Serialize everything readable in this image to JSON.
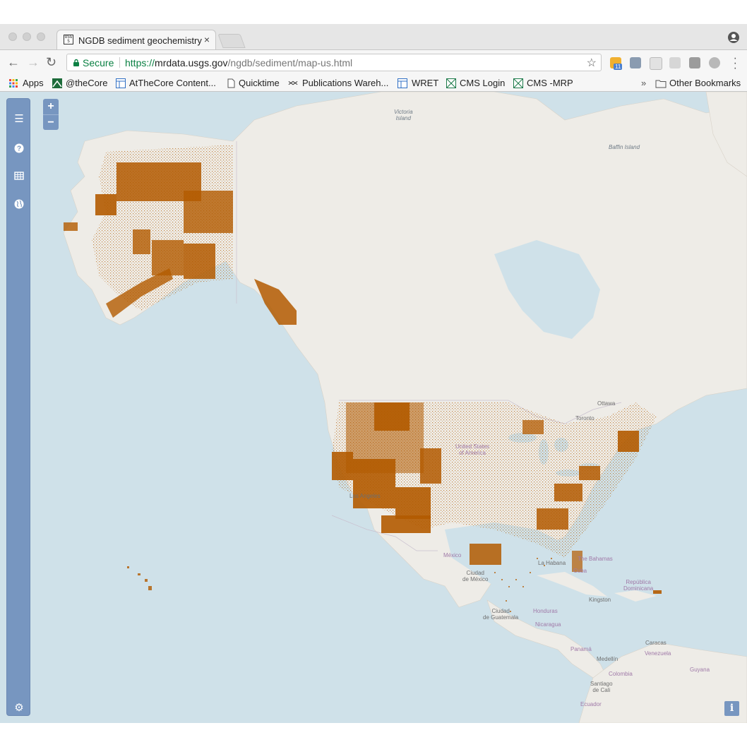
{
  "browser": {
    "tab": {
      "title": "NGDB sediment geochemistry",
      "favicon_text": "USGS",
      "close_glyph": "×"
    },
    "address": {
      "secure_label": "Secure",
      "url_scheme": "https://",
      "url_host": "mrdata.usgs.gov",
      "url_path": "/ngdb/sediment/map-us.html"
    },
    "bookmarks": [
      {
        "label": "Apps",
        "icon": "apps-grid-icon"
      },
      {
        "label": "@theCore",
        "icon": "thecore-icon"
      },
      {
        "label": "AtTheCore Content...",
        "icon": "table-icon"
      },
      {
        "label": "Quicktime",
        "icon": "page-icon"
      },
      {
        "label": "Publications Wareh...",
        "icon": "pubs-icon"
      },
      {
        "label": "WRET",
        "icon": "table-icon"
      },
      {
        "label": "CMS Login",
        "icon": "cms-icon"
      },
      {
        "label": "CMS -MRP",
        "icon": "cms-icon"
      }
    ],
    "other_bookmarks": "Other Bookmarks",
    "overflow_glyph": "»",
    "extension_badge": "11"
  },
  "map": {
    "zoom_in": "+",
    "zoom_out": "−",
    "info": "i",
    "sidebar_icons": [
      "menu-icon",
      "help-icon",
      "table-icon",
      "globe-icon",
      "settings-icon"
    ],
    "labels": {
      "victoria_island": "Victoria\nIsland",
      "baffin_island": "Baffin Island",
      "ottawa": "Ottawa",
      "toronto": "Toronto",
      "united_states": "United States\nof America",
      "los_angeles": "Los Angeles",
      "mexico": "México",
      "ciudad_de_mexico": "Ciudad\nde México",
      "la_habana": "La Habana",
      "the_bahamas": "The Bahamas",
      "cuba": "Cuba",
      "republica_dominicana": "República\nDominicana",
      "kingston": "Kingston",
      "honduras": "Honduras",
      "nicaragua": "Nicaragua",
      "ciudad_de_guatemala": "Ciudad\nde Guatemala",
      "panama": "Panamá",
      "caracas": "Caracas",
      "venezuela": "Venezuela",
      "guyana": "Guyana",
      "medellin": "Medellín",
      "colombia": "Colombia",
      "santiago_de_cali": "Santiago\nde Cali",
      "ecuador": "Ecuador"
    },
    "colors": {
      "water": "#cfe1e9",
      "land": "#eeece7",
      "samples": "#b35b00",
      "panel": "#7796c0"
    }
  }
}
